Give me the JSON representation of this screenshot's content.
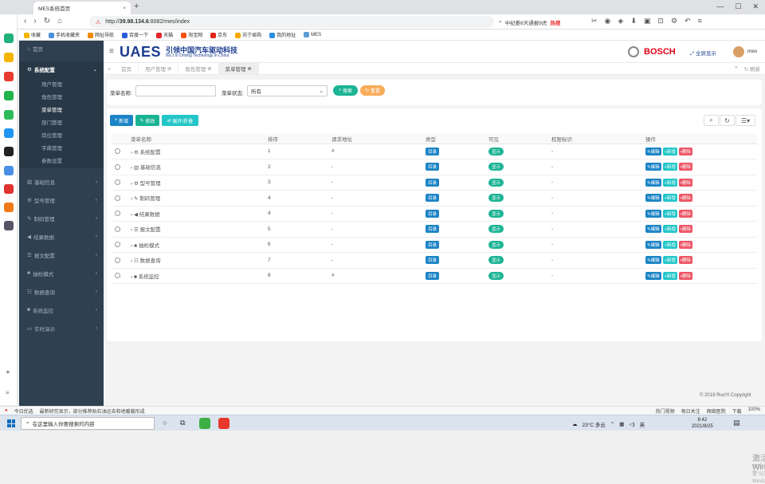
{
  "browser": {
    "tab_title": "MES系统首页",
    "url_prefix": "http://",
    "url_host": "39.98.134.6",
    "url_rest": ":8082/mes/index",
    "search_text": "中纪委8天通报9虎",
    "search_hot": "热搜"
  },
  "bookmarks": [
    "收藏",
    "手机收藏夹",
    "网址导航",
    "百度一下",
    "天猫",
    "淘宝网",
    "京东",
    "苏宁易购",
    "我的地址",
    "MES"
  ],
  "header": {
    "logo": "UAES",
    "logo_cn": "引领中国汽车驱动科技",
    "logo_en": "No.1 in Driving Technology in China",
    "brand": "BOSCH",
    "fullscreen": "全屏显示",
    "user": "mes"
  },
  "sidebar": {
    "home": "首页",
    "system": "系统配置",
    "sub": [
      "用户管理",
      "角色管理",
      "菜单管理",
      "部门管理",
      "岗位管理",
      "字典管理",
      "参数设置"
    ],
    "groups": [
      "基础信息",
      "型号管理",
      "制码管理",
      "结果数据",
      "报文配置",
      "抽检模式",
      "数据查询",
      "系统监控",
      "实时演示"
    ]
  },
  "pagetabs": [
    "首页",
    "用户管理",
    "角色管理",
    "菜单管理"
  ],
  "pagetab_refresh": "刷新",
  "filter": {
    "name_label": "菜单名称:",
    "status_label": "菜单状态:",
    "status_value": "所有",
    "search_btn": "搜索",
    "reset_btn": "重置"
  },
  "toolbar": {
    "add": "新增",
    "edit": "修改",
    "expand": "展开/折叠"
  },
  "table": {
    "columns": [
      "菜单名称",
      "排序",
      "请求地址",
      "类型",
      "可见",
      "权限标识",
      "操作"
    ],
    "rows": [
      {
        "name": "系统配置",
        "order": "1",
        "url": "#",
        "type": "目录",
        "visible": "显示",
        "perm": "-"
      },
      {
        "name": "基础信息",
        "order": "2",
        "url": "-",
        "type": "目录",
        "visible": "显示",
        "perm": "-"
      },
      {
        "name": "型号管理",
        "order": "3",
        "url": "-",
        "type": "目录",
        "visible": "显示",
        "perm": "-"
      },
      {
        "name": "制码管理",
        "order": "4",
        "url": "-",
        "type": "目录",
        "visible": "显示",
        "perm": "-"
      },
      {
        "name": "结果数据",
        "order": "4",
        "url": "-",
        "type": "目录",
        "visible": "显示",
        "perm": "-"
      },
      {
        "name": "报文配置",
        "order": "5",
        "url": "-",
        "type": "目录",
        "visible": "显示",
        "perm": "-"
      },
      {
        "name": "抽检模式",
        "order": "6",
        "url": "-",
        "type": "目录",
        "visible": "显示",
        "perm": "-"
      },
      {
        "name": "数据查询",
        "order": "7",
        "url": "-",
        "type": "目录",
        "visible": "显示",
        "perm": "-"
      },
      {
        "name": "系统监控",
        "order": "8",
        "url": "#",
        "type": "目录",
        "visible": "显示",
        "perm": "-"
      }
    ],
    "op_edit": "编辑",
    "op_add": "新增",
    "op_del": "删除"
  },
  "footer": {
    "win1": "激活 Windows",
    "win2": "转到\"设置\"以激活 Windows。",
    "copyright": "© 2019 RuoYi Copyright"
  },
  "statusbar": {
    "left1": "今日优选",
    "left2": "最新研究显示，部分推荐贴石油远去和地暖载形成",
    "right": [
      "热门视频",
      "每日关注",
      "网络医院",
      "下载",
      "100%"
    ]
  },
  "taskbar": {
    "search": "在这里输入你要搜索的内容",
    "weather": "23°C 多云",
    "lang": "英",
    "time": "8:42",
    "date": "2021/8/25"
  }
}
